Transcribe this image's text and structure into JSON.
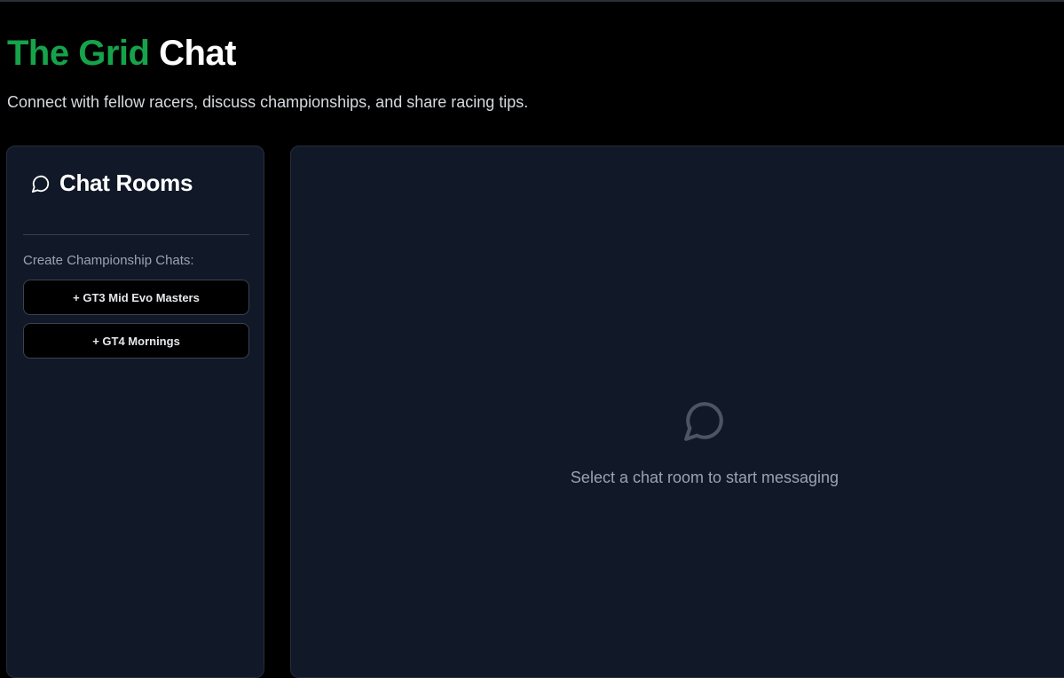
{
  "header": {
    "title_accent": "The Grid",
    "title_main": "Chat",
    "subtitle": "Connect with fellow racers, discuss championships, and share racing tips."
  },
  "sidebar": {
    "icon": "chat-bubble-icon",
    "title": "Chat Rooms",
    "create_label": "Create Championship Chats:",
    "championship_buttons": [
      {
        "label": "+ GT3 Mid Evo Masters"
      },
      {
        "label": "+ GT4 Mornings"
      }
    ]
  },
  "main": {
    "empty_icon": "chat-bubble-icon",
    "empty_message": "Select a chat room to start messaging"
  },
  "colors": {
    "accent": "#16a34a",
    "background": "#000000",
    "panel": "#111827",
    "muted_text": "#9ca3af"
  }
}
